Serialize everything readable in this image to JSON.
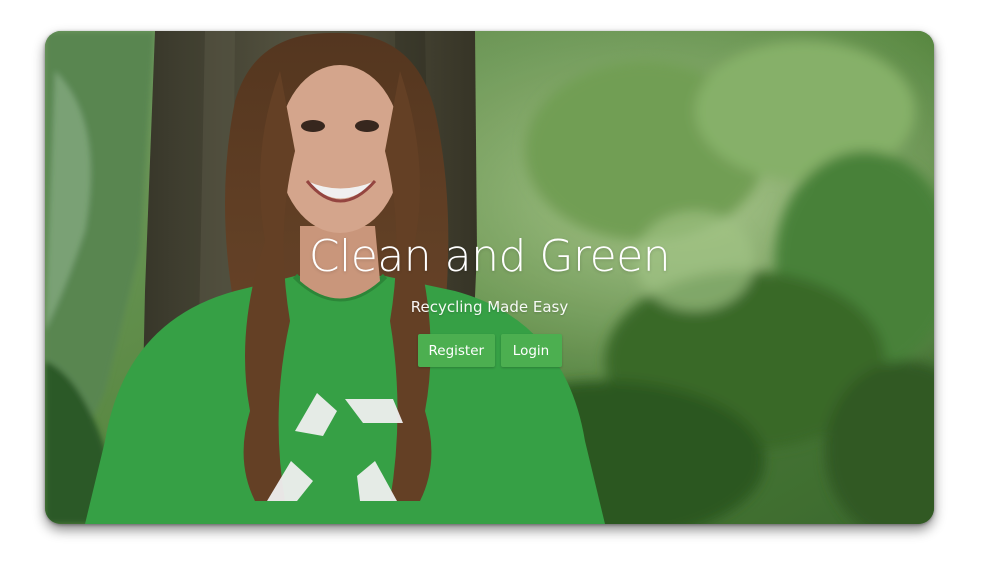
{
  "hero": {
    "title": "Clean and Green",
    "subtitle": "Recycling Made Easy",
    "register_label": "Register",
    "login_label": "Login"
  },
  "theme": {
    "accent": "#4caf50",
    "text": "#ffffff",
    "foliage": "#3f7a2e"
  },
  "hero_image": {
    "subject": "smiling-woman-recycling-tshirt",
    "icon": "recycle-icon"
  }
}
